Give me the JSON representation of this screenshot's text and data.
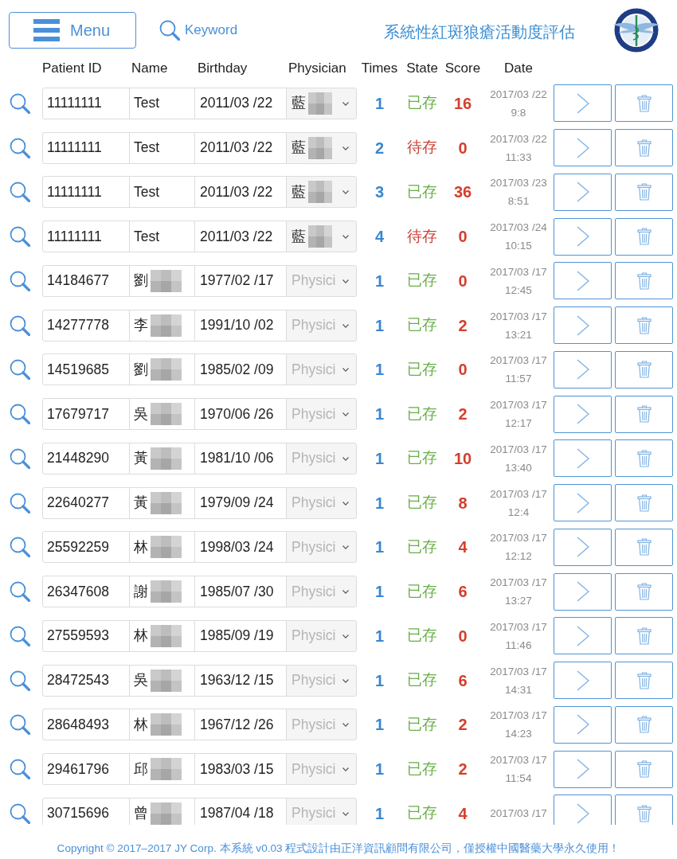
{
  "menu_button": {
    "label": "Menu"
  },
  "search": {
    "placeholder": "Keyword"
  },
  "title": "系統性紅斑狼瘡活動度評估",
  "columns": [
    "Patient ID",
    "Name",
    "Birthday",
    "Physician",
    "Times",
    "State",
    "Score",
    "Date"
  ],
  "rows": [
    {
      "patient_id": "11111111",
      "name": "Test",
      "name_redacted": false,
      "birthday": "2011/03 /22",
      "physician": {
        "value": "藍",
        "redacted": true
      },
      "times": "1",
      "state": "已存",
      "saved": true,
      "score": "16",
      "date": "2017/03 /22",
      "time": "9:8"
    },
    {
      "patient_id": "11111111",
      "name": "Test",
      "name_redacted": false,
      "birthday": "2011/03 /22",
      "physician": {
        "value": "藍",
        "redacted": true
      },
      "times": "2",
      "state": "待存",
      "saved": false,
      "score": "0",
      "date": "2017/03 /22",
      "time": "11:33"
    },
    {
      "patient_id": "11111111",
      "name": "Test",
      "name_redacted": false,
      "birthday": "2011/03 /22",
      "physician": {
        "value": "藍",
        "redacted": true
      },
      "times": "3",
      "state": "已存",
      "saved": true,
      "score": "36",
      "date": "2017/03 /23",
      "time": "8:51"
    },
    {
      "patient_id": "11111111",
      "name": "Test",
      "name_redacted": false,
      "birthday": "2011/03 /22",
      "physician": {
        "value": "藍",
        "redacted": true
      },
      "times": "4",
      "state": "待存",
      "saved": false,
      "score": "0",
      "date": "2017/03 /24",
      "time": "10:15"
    },
    {
      "patient_id": "14184677",
      "name": "劉",
      "name_redacted": true,
      "birthday": "1977/02 /17",
      "physician": {
        "placeholder": "Physici",
        "redacted": false
      },
      "times": "1",
      "state": "已存",
      "saved": true,
      "score": "0",
      "date": "2017/03 /17",
      "time": "12:45"
    },
    {
      "patient_id": "14277778",
      "name": "李",
      "name_redacted": true,
      "birthday": "1991/10 /02",
      "physician": {
        "placeholder": "Physici",
        "redacted": false
      },
      "times": "1",
      "state": "已存",
      "saved": true,
      "score": "2",
      "date": "2017/03 /17",
      "time": "13:21"
    },
    {
      "patient_id": "14519685",
      "name": "劉",
      "name_redacted": true,
      "birthday": "1985/02 /09",
      "physician": {
        "placeholder": "Physici",
        "redacted": false
      },
      "times": "1",
      "state": "已存",
      "saved": true,
      "score": "0",
      "date": "2017/03 /17",
      "time": "11:57"
    },
    {
      "patient_id": "17679717",
      "name": "吳",
      "name_redacted": true,
      "birthday": "1970/06 /26",
      "physician": {
        "placeholder": "Physici",
        "redacted": false
      },
      "times": "1",
      "state": "已存",
      "saved": true,
      "score": "2",
      "date": "2017/03 /17",
      "time": "12:17"
    },
    {
      "patient_id": "21448290",
      "name": "黃",
      "name_redacted": true,
      "birthday": "1981/10 /06",
      "physician": {
        "placeholder": "Physici",
        "redacted": false
      },
      "times": "1",
      "state": "已存",
      "saved": true,
      "score": "10",
      "date": "2017/03 /17",
      "time": "13:40"
    },
    {
      "patient_id": "22640277",
      "name": "黃",
      "name_redacted": true,
      "birthday": "1979/09 /24",
      "physician": {
        "placeholder": "Physici",
        "redacted": false
      },
      "times": "1",
      "state": "已存",
      "saved": true,
      "score": "8",
      "date": "2017/03 /17",
      "time": "12:4"
    },
    {
      "patient_id": "25592259",
      "name": "林",
      "name_redacted": true,
      "birthday": "1998/03 /24",
      "physician": {
        "placeholder": "Physici",
        "redacted": false
      },
      "times": "1",
      "state": "已存",
      "saved": true,
      "score": "4",
      "date": "2017/03 /17",
      "time": "12:12"
    },
    {
      "patient_id": "26347608",
      "name": "謝",
      "name_redacted": true,
      "birthday": "1985/07 /30",
      "physician": {
        "placeholder": "Physici",
        "redacted": false
      },
      "times": "1",
      "state": "已存",
      "saved": true,
      "score": "6",
      "date": "2017/03 /17",
      "time": "13:27"
    },
    {
      "patient_id": "27559593",
      "name": "林",
      "name_redacted": true,
      "birthday": "1985/09 /19",
      "physician": {
        "placeholder": "Physici",
        "redacted": false
      },
      "times": "1",
      "state": "已存",
      "saved": true,
      "score": "0",
      "date": "2017/03 /17",
      "time": "11:46"
    },
    {
      "patient_id": "28472543",
      "name": "吳",
      "name_redacted": true,
      "birthday": "1963/12 /15",
      "physician": {
        "placeholder": "Physici",
        "redacted": false
      },
      "times": "1",
      "state": "已存",
      "saved": true,
      "score": "6",
      "date": "2017/03 /17",
      "time": "14:31"
    },
    {
      "patient_id": "28648493",
      "name": "林",
      "name_redacted": true,
      "birthday": "1967/12 /26",
      "physician": {
        "placeholder": "Physici",
        "redacted": false
      },
      "times": "1",
      "state": "已存",
      "saved": true,
      "score": "2",
      "date": "2017/03 /17",
      "time": "14:23"
    },
    {
      "patient_id": "29461796",
      "name": "邱",
      "name_redacted": true,
      "birthday": "1983/03 /15",
      "physician": {
        "placeholder": "Physici",
        "redacted": false
      },
      "times": "1",
      "state": "已存",
      "saved": true,
      "score": "2",
      "date": "2017/03 /17",
      "time": "11:54"
    },
    {
      "patient_id": "30715696",
      "name": "曾",
      "name_redacted": true,
      "birthday": "1987/04 /18",
      "physician": {
        "placeholder": "Physici",
        "redacted": false
      },
      "times": "1",
      "state": "已存",
      "saved": true,
      "score": "4",
      "date": "2017/03 /17"
    }
  ],
  "footer": "Copyright © 2017–2017 JY Corp. 本系統 v0.03 程式設計由正洋資訊顧問有限公司，僅授權中國醫藥大學永久使用！"
}
